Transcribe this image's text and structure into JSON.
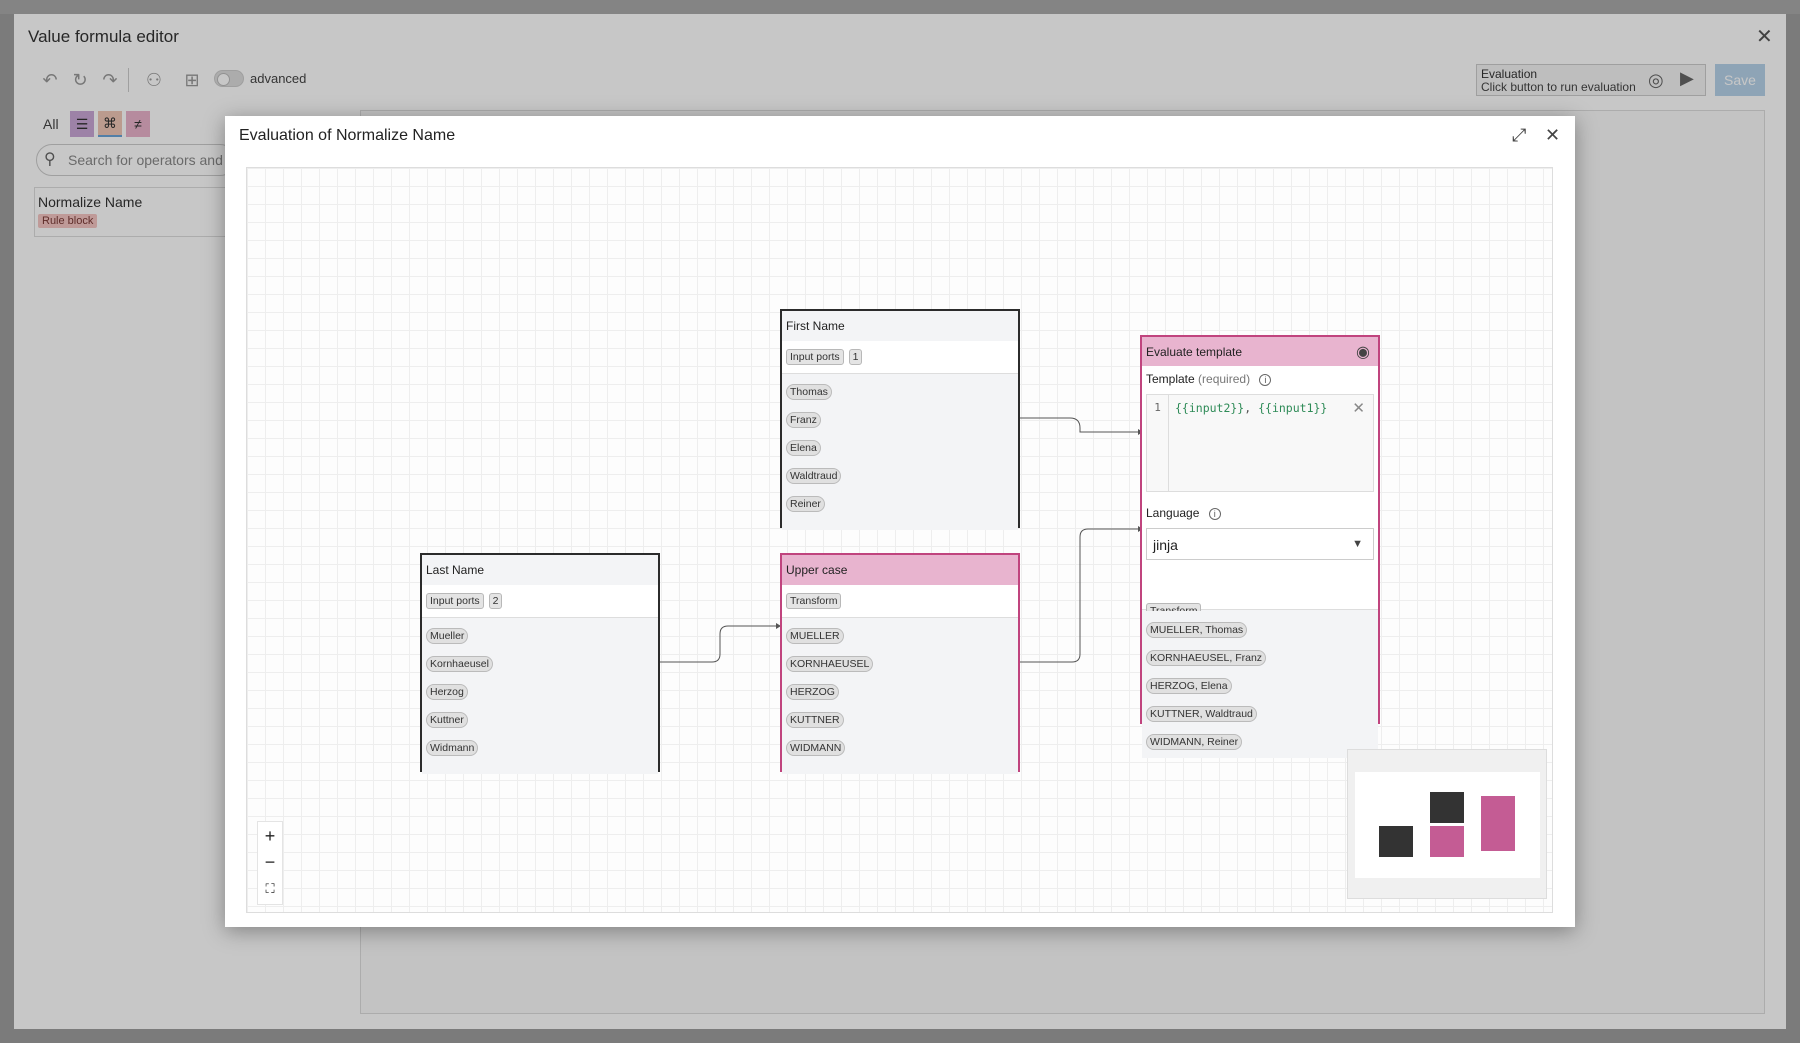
{
  "editor": {
    "title": "Value formula editor",
    "advanced_label": "advanced",
    "evaluation_title": "Evaluation",
    "evaluation_subtitle": "Click button to run evaluation",
    "save_label": "Save",
    "filter_all_label": "All",
    "search_placeholder": "Search for operators and",
    "library_item_title": "Normalize Name",
    "library_item_tag": "Rule block"
  },
  "modal": {
    "title": "Evaluation of Normalize Name"
  },
  "nodes": {
    "first_name": {
      "title": "First Name",
      "port_label": "Input ports",
      "port_value": "1",
      "values": [
        "Thomas",
        "Franz",
        "Elena",
        "Waldtraud",
        "Reiner"
      ]
    },
    "last_name": {
      "title": "Last Name",
      "port_label": "Input ports",
      "port_value": "2",
      "values": [
        "Mueller",
        "Kornhaeusel",
        "Herzog",
        "Kuttner",
        "Widmann"
      ]
    },
    "upper_case": {
      "title": "Upper case",
      "port_label": "Transform",
      "values": [
        "MUELLER",
        "KORNHAEUSEL",
        "HERZOG",
        "KUTTNER",
        "WIDMANN"
      ]
    },
    "evaluate_template": {
      "title": "Evaluate template",
      "template_label": "Template",
      "template_required": "(required)",
      "code_line_number": "1",
      "code_part1": "{{input2}}",
      "code_sep": ", ",
      "code_part2": "{{input1}}",
      "language_label": "Language",
      "language_value": "jinja",
      "transform_tag": "Transform",
      "results": [
        "MUELLER, Thomas",
        "KORNHAEUSEL, Franz",
        "HERZOG, Elena",
        "KUTTNER, Waldtraud",
        "WIDMANN, Reiner"
      ]
    }
  },
  "colors": {
    "accent_pink": "#c0447e",
    "node_head_pink": "#e8b4cf",
    "code_green": "#2e8b57",
    "save_button": "#b7d3ea"
  },
  "icons": {
    "undo": "undo-icon",
    "redo": "redo-icon",
    "operators": "operators-icon",
    "add_note": "add-note-icon",
    "eye": "eye-icon",
    "play": "play-icon",
    "close": "close-icon",
    "maximize": "maximize-icon",
    "zoom_in": "plus-icon",
    "zoom_out": "minus-icon",
    "fit": "fit-view-icon"
  }
}
